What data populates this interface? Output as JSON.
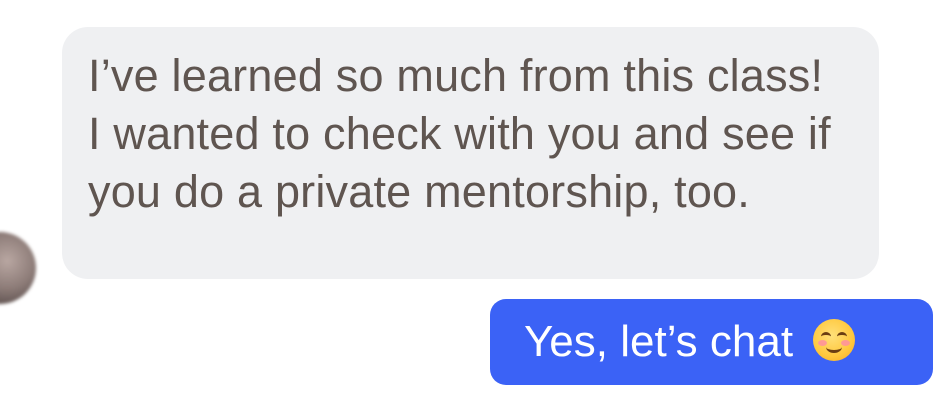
{
  "conversation": {
    "incoming_message": {
      "text": "I’ve learned so much from this class! I wanted to check with you and see if you do a private mentorship, too."
    },
    "outgoing_message": {
      "text": "Yes, let’s chat",
      "emoji": "smiling-face-with-smiling-eyes"
    }
  },
  "colors": {
    "incoming_bubble": "#eff0f2",
    "incoming_text": "#5f5550",
    "outgoing_bubble": "#3b62f6",
    "outgoing_text": "#ffffff"
  }
}
